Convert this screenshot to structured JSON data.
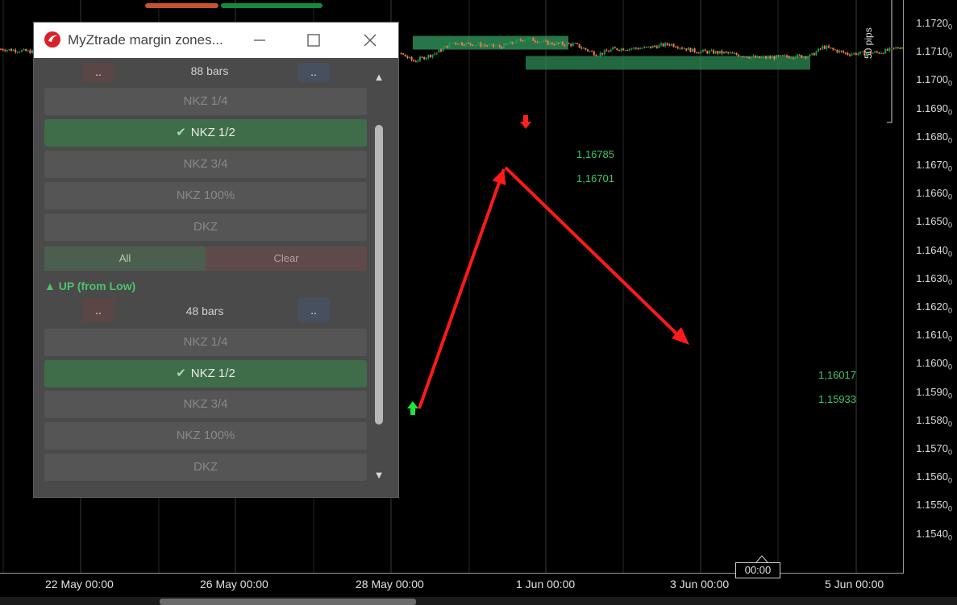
{
  "chart": {
    "price_axis": [
      "1.1720",
      "1.1710",
      "1.1700",
      "1.1690",
      "1.1680",
      "1.1670",
      "1.1660",
      "1.1650",
      "1.1640",
      "1.1630",
      "1.1620",
      "1.1610",
      "1.1600",
      "1.1590",
      "1.1580",
      "1.1570",
      "1.1560",
      "1.1550",
      "1.1540"
    ],
    "price_axis_suffix": "0",
    "date_axis": [
      "22 May 00:00",
      "26 May 00:00",
      "28 May 00:00",
      "1 Jun 00:00",
      "3 Jun 00:00",
      "5 Jun 00:00"
    ],
    "crosshair_time": "00:00",
    "ruler_label": "50 pips",
    "upper_zone": {
      "high": "1,16785",
      "low": "1,16701"
    },
    "lower_zone": {
      "high": "1,16017",
      "low": "1,15933"
    },
    "colors": {
      "bull": "#1e9b4c",
      "bear": "#ff7b4a",
      "zone": "#2e8b57",
      "arrow": "#ff1a1a",
      "up_marker": "#19e53a",
      "down_marker": "#ff2020"
    }
  },
  "panel": {
    "title": "MyZtrade margin zones...",
    "icons": {
      "app": "app-logo-icon",
      "minimize": "minimize-icon",
      "maximize": "maximize-icon",
      "close": "close-icon"
    },
    "top_section": {
      "bars": "88 bars",
      "left_btn": "..",
      "right_btn": "..",
      "items": [
        {
          "label": "NKZ 1/4",
          "active": false
        },
        {
          "label": "NKZ 1/2",
          "active": true
        },
        {
          "label": "NKZ 3/4",
          "active": false
        },
        {
          "label": "NKZ 100%",
          "active": false
        },
        {
          "label": "DKZ",
          "active": false
        }
      ]
    },
    "all_label": "All",
    "clear_label": "Clear",
    "up_section": {
      "title": "UP (from Low)",
      "bars": "48 bars",
      "left_btn": "..",
      "right_btn": "..",
      "items": [
        {
          "label": "NKZ 1/4",
          "active": false
        },
        {
          "label": "NKZ 1/2",
          "active": true
        },
        {
          "label": "NKZ 3/4",
          "active": false
        },
        {
          "label": "NKZ 100%",
          "active": false
        },
        {
          "label": "DKZ",
          "active": false
        }
      ]
    },
    "check_glyph": "✔",
    "scroll_up_glyph": "▲",
    "scroll_down_glyph": "▼",
    "up_glyph": "▲"
  }
}
